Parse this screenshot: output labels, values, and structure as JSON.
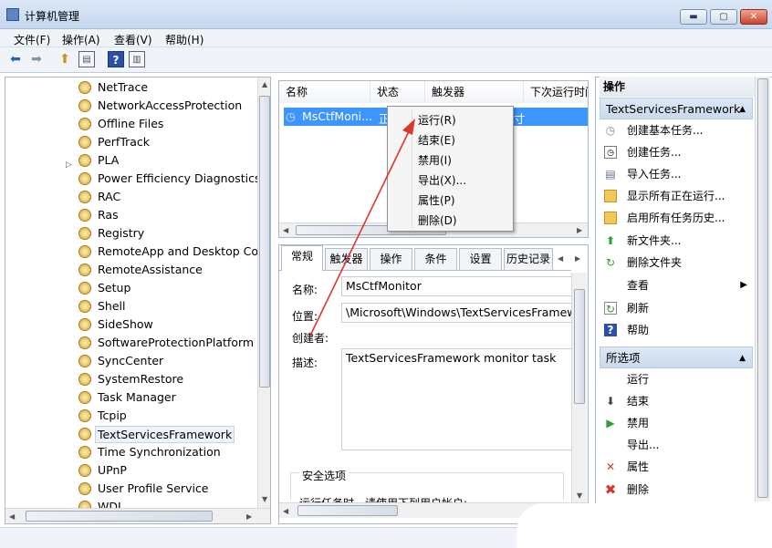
{
  "window": {
    "title": "计算机管理",
    "controls": {
      "minimize": "▬",
      "maximize": "▢",
      "close": "✕"
    }
  },
  "menubar": {
    "items": [
      "文件(F)",
      "操作(A)",
      "查看(V)",
      "帮助(H)"
    ]
  },
  "toolbar": {
    "icons": [
      "back-arrow-icon",
      "forward-arrow-icon",
      "up-folder-icon",
      "show-hide-tree-icon",
      "help-icon",
      "properties-icon"
    ]
  },
  "tree": {
    "items": [
      {
        "label": "NetTrace"
      },
      {
        "label": "NetworkAccessProtection"
      },
      {
        "label": "Offline Files"
      },
      {
        "label": "PerfTrack"
      },
      {
        "label": "PLA",
        "expandable": true
      },
      {
        "label": "Power Efficiency Diagnostics"
      },
      {
        "label": "RAC"
      },
      {
        "label": "Ras"
      },
      {
        "label": "Registry"
      },
      {
        "label": "RemoteApp and Desktop Conn"
      },
      {
        "label": "RemoteAssistance"
      },
      {
        "label": "Setup"
      },
      {
        "label": "Shell"
      },
      {
        "label": "SideShow"
      },
      {
        "label": "SoftwareProtectionPlatform"
      },
      {
        "label": "SyncCenter"
      },
      {
        "label": "SystemRestore"
      },
      {
        "label": "Task Manager"
      },
      {
        "label": "Tcpip"
      },
      {
        "label": "TextServicesFramework",
        "selected": true
      },
      {
        "label": "Time Synchronization"
      },
      {
        "label": "UPnP"
      },
      {
        "label": "User Profile Service"
      },
      {
        "label": "WDI"
      }
    ]
  },
  "task_list": {
    "columns": [
      "名称",
      "状态",
      "触发器",
      "下次运行时间"
    ],
    "rows": [
      {
        "name": "MsCtfMoni...",
        "status": "正",
        "next_run": "寸"
      }
    ]
  },
  "context_menu": {
    "items": [
      "运行(R)",
      "结束(E)",
      "禁用(I)",
      "导出(X)...",
      "属性(P)",
      "删除(D)"
    ]
  },
  "detail": {
    "tabs": [
      "常规",
      "触发器",
      "操作",
      "条件",
      "设置",
      "历史记录"
    ],
    "fields": {
      "name_label": "名称:",
      "name_value": "MsCtfMonitor",
      "location_label": "位置:",
      "location_value": "\\Microsoft\\Windows\\TextServicesFramewo",
      "author_label": "创建者:",
      "desc_label": "描述:",
      "desc_value": "TextServicesFramework monitor task"
    },
    "security_group": "安全选项",
    "security_text": "运行任务时，请使用下列用户帐户:"
  },
  "actions": {
    "header": "操作",
    "section1": {
      "title": "TextServicesFramework",
      "items": [
        {
          "label": "创建基本任务...",
          "icon": "clock-task-icon"
        },
        {
          "label": "创建任务...",
          "icon": "task-icon"
        },
        {
          "label": "导入任务...",
          "icon": "import-icon"
        },
        {
          "label": "显示所有正在运行...",
          "icon": "folder-icon"
        },
        {
          "label": "启用所有任务历史...",
          "icon": "folder-icon"
        },
        {
          "label": "新文件夹...",
          "icon": "new-folder-icon"
        },
        {
          "label": "删除文件夹",
          "icon": "refresh-icon"
        },
        {
          "label": "查看",
          "icon": "",
          "submenu": true
        },
        {
          "label": "刷新",
          "icon": "refresh-icon"
        },
        {
          "label": "帮助",
          "icon": "help-icon"
        }
      ]
    },
    "section2": {
      "title": "所选项",
      "items": [
        {
          "label": "运行",
          "icon": ""
        },
        {
          "label": "结束",
          "icon": "stop-arrow-icon"
        },
        {
          "label": "禁用",
          "icon": "play-icon"
        },
        {
          "label": "导出...",
          "icon": ""
        },
        {
          "label": "属性",
          "icon": "close-x-icon"
        },
        {
          "label": "删除",
          "icon": "delete-x-icon"
        }
      ]
    }
  },
  "colors": {
    "selection": "#3d95ff",
    "section_header": "#c9daed",
    "annotation_arrow": "#e0352b"
  }
}
